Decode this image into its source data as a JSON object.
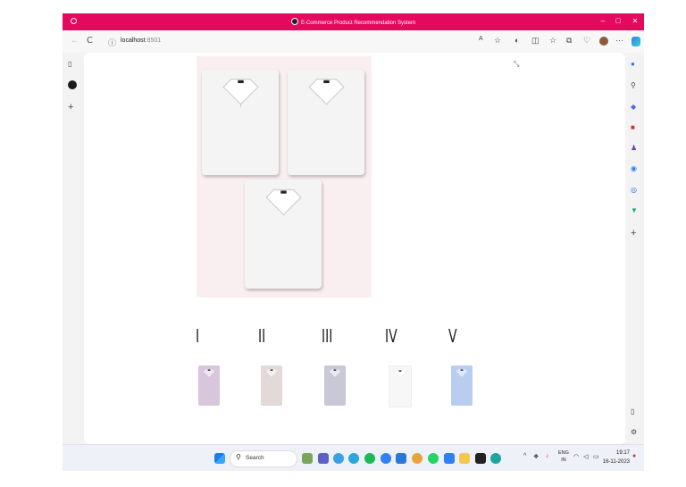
{
  "window": {
    "title": "E-Commerce Product Recommendation System",
    "min": "–",
    "max": "▢",
    "close": "✕"
  },
  "navbar": {
    "back": "←",
    "refresh": "C",
    "url_host": "localhost",
    "url_port": ":8501",
    "read_aloud": "A",
    "favorites": "☆",
    "more": "···"
  },
  "sidebar": {
    "tabs_icon": "▯",
    "add": "+"
  },
  "right_sidebar": {
    "add": "+"
  },
  "product": {
    "shirt_color": "#f4f4f4"
  },
  "recommendations": [
    {
      "label": "I",
      "color": "#d8c6dc"
    },
    {
      "label": "II",
      "color": "#e2d9d9"
    },
    {
      "label": "III",
      "color": "#c9c8d6"
    },
    {
      "label": "IV",
      "color": "#f7f7f7"
    },
    {
      "label": "V",
      "color": "#b9cdf0"
    }
  ],
  "taskbar": {
    "search_label": "Search",
    "lang_top": "ENG",
    "lang_bottom": "IN",
    "time": "19:17",
    "date": "16-11-2023"
  },
  "colors": {
    "titlebar": "#e5085f"
  }
}
